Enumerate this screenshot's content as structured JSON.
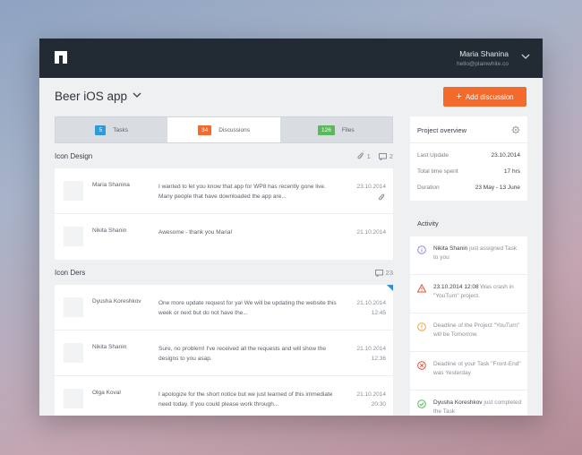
{
  "header": {
    "user_name": "Maria Shanina",
    "user_email": "hello@plainwhite.co"
  },
  "project": {
    "title": "Beer iOS app",
    "add_label": "Add discussion"
  },
  "tabs": [
    {
      "label": "Tasks",
      "count": "5",
      "color": "#2f9ad8"
    },
    {
      "label": "Discussions",
      "count": "34",
      "color": "#f26b2c"
    },
    {
      "label": "Files",
      "count": "126",
      "color": "#5cb85c"
    }
  ],
  "sections": [
    {
      "title": "Icon Design",
      "attachments": "1",
      "comments": "2",
      "rows": [
        {
          "name": "Maria Shanina",
          "message": "I wanted to let you know that app for WP8 has recently gone live. Many people that have downloaded the app are...",
          "date": "23.10.2014",
          "time": ""
        },
        {
          "name": "Nikita Shanin",
          "message": "Awesome - thank you Maria!",
          "date": "21.10.2014",
          "time": ""
        }
      ]
    },
    {
      "title": "Icon Ders",
      "comments": "23",
      "rows": [
        {
          "name": "Dyusha Koreshkov",
          "message": "One more update request for ya! We will be updating the website this week or next but do not have the...",
          "date": "21.10.2014",
          "time": "12:45"
        },
        {
          "name": "Nikita Shanin",
          "message": "Sure, no problem! I've received all the requests and will show the designs to you asap.",
          "date": "21.10.2014",
          "time": "12:36"
        },
        {
          "name": "Olga Koval",
          "message": "I apologize for the short notice but we just learned of this immediate need today. If you could please work through...",
          "date": "21.10.2014",
          "time": "20:30"
        }
      ]
    }
  ],
  "overview": {
    "title": "Project overview",
    "stats": [
      {
        "label": "Last Update",
        "value": "23.10.2014"
      },
      {
        "label": "Total time spent",
        "value": "17 hrs"
      },
      {
        "label": "Duration",
        "value": "23 May - 13 June"
      }
    ]
  },
  "activity": {
    "title": "Activity",
    "items": [
      {
        "icon": "info-icon",
        "color": "#8a8fd8",
        "bold": "Nikita Shanin",
        "text": " just assigned Task to you"
      },
      {
        "icon": "warning-icon",
        "color": "#e0533b",
        "bold": "23.10.2014 12:08",
        "text": " Was crash in \"YouTurn\" project."
      },
      {
        "icon": "alert-icon",
        "color": "#f2a03a",
        "bold": "",
        "text": "Deadline of the Project \"YouTurn\" will be Tomorrow."
      },
      {
        "icon": "error-icon",
        "color": "#e0533b",
        "bold": "",
        "text": "Deadline ot your Task \"Front-End\" was Yesterday"
      },
      {
        "icon": "check-icon",
        "color": "#5cb85c",
        "bold": "Dyusha Koreshkov",
        "text": " just completed the Task"
      }
    ]
  }
}
